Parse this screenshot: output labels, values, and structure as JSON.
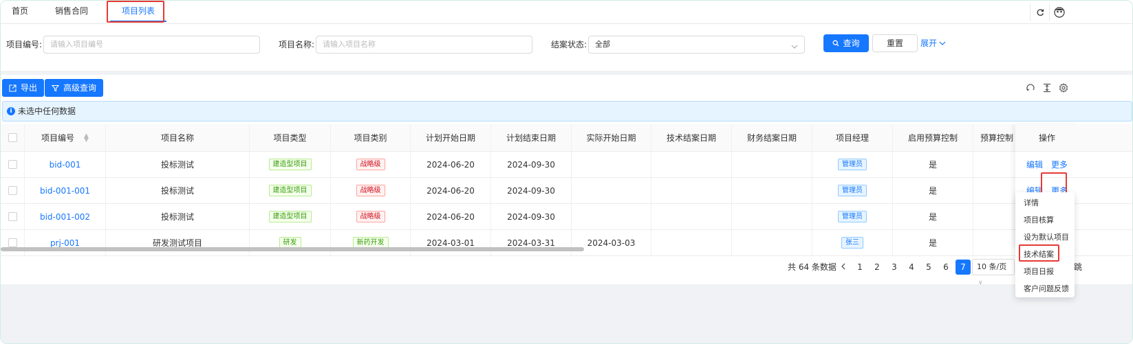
{
  "tabs": [
    {
      "label": "首页"
    },
    {
      "label": "销售合同"
    },
    {
      "label": "项目列表"
    }
  ],
  "top_actions": {
    "refresh_icon": "refresh-icon",
    "avatar_icon": "avatar-icon"
  },
  "search": {
    "project_no_label": "项目编号:",
    "project_no_placeholder": "请输入项目编号",
    "project_name_label": "项目名称:",
    "project_name_placeholder": "请输入项目名称",
    "status_label": "结案状态:",
    "status_value": "全部",
    "query_label": "查询",
    "reset_label": "重置",
    "expand_label": "展开"
  },
  "toolbar": {
    "export_label": "导出",
    "advanced_label": "高级查询"
  },
  "alert": {
    "text": "未选中任何数据"
  },
  "table": {
    "headers": [
      "项目编号",
      "项目名称",
      "项目类型",
      "项目类别",
      "计划开始日期",
      "计划结束日期",
      "实际开始日期",
      "技术结案日期",
      "财务结案日期",
      "项目经理",
      "启用预算控制",
      "预算控制"
    ],
    "op_header": "操作",
    "rows": [
      {
        "no": "bid-001",
        "name": "投标测试",
        "type": "建造型项目",
        "category": "战略级",
        "plan_start": "2024-06-20",
        "plan_end": "2024-09-30",
        "actual_start": "",
        "tech_close": "",
        "fin_close": "",
        "manager": "管理员",
        "budget": "是"
      },
      {
        "no": "bid-001-001",
        "name": "投标测试",
        "type": "建造型项目",
        "category": "战略级",
        "plan_start": "2024-06-20",
        "plan_end": "2024-09-30",
        "actual_start": "",
        "tech_close": "",
        "fin_close": "",
        "manager": "管理员",
        "budget": "是"
      },
      {
        "no": "bid-001-002",
        "name": "投标测试",
        "type": "建造型项目",
        "category": "战略级",
        "plan_start": "2024-06-20",
        "plan_end": "2024-09-30",
        "actual_start": "",
        "tech_close": "",
        "fin_close": "",
        "manager": "管理员",
        "budget": "是"
      },
      {
        "no": "prj-001",
        "name": "研发测试项目",
        "type": "研发",
        "category": "新药开发",
        "plan_start": "2024-03-01",
        "plan_end": "2024-03-31",
        "actual_start": "2024-03-03",
        "tech_close": "",
        "fin_close": "",
        "manager": "张三",
        "budget": "是"
      }
    ],
    "edit_label": "编辑",
    "more_label": "更多"
  },
  "pagination": {
    "total": "共 64 条数据",
    "pages": [
      "1",
      "2",
      "3",
      "4",
      "5",
      "6",
      "7"
    ],
    "current": "7",
    "page_size": "10 条/页",
    "jump_label": "跳"
  },
  "dropdown": {
    "items": [
      "详情",
      "项目核算",
      "设为默认项目",
      "技术结案",
      "项目日报",
      "客户问题反馈"
    ]
  },
  "colors": {
    "primary": "#1677ff",
    "highlight": "#e53935"
  }
}
